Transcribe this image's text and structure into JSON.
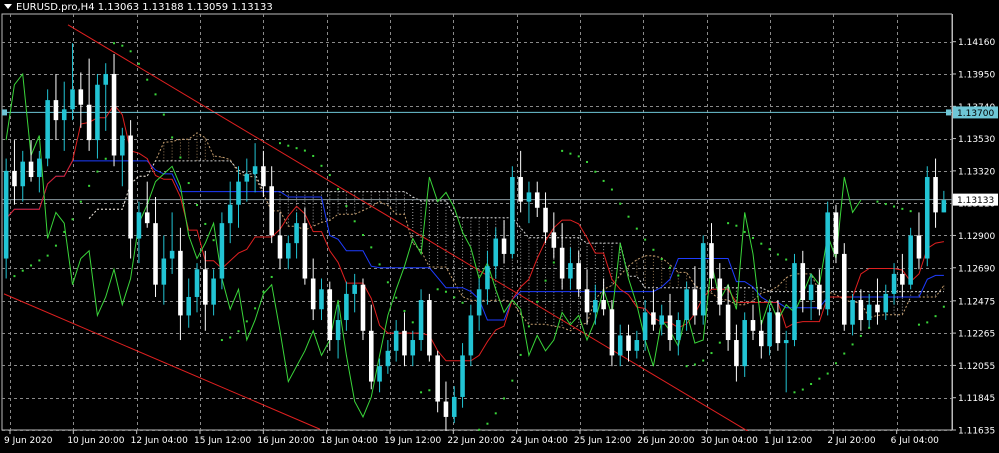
{
  "window": {
    "symbol_line": "EURUSD.pro,H4  1.13063 1.13188 1.13059 1.13133"
  },
  "colors": {
    "background": "#000000",
    "grid": "#8a8a8a",
    "bull_candle": "#22c4d4",
    "bear_candle": "#ffffff",
    "hline": "#6ec6d6",
    "trendline": "#e02020",
    "tenkan": "#e02020",
    "kijun": "#1e3cff",
    "chikou": "#3ad63a",
    "psar": "#3ad63a",
    "cloud_a": "#c8a070",
    "cloud_b": "#d8d8d8"
  },
  "price_axis": {
    "min": 1.11635,
    "max": 1.1434,
    "ticks": [
      "1.14160",
      "1.13950",
      "1.13740",
      "1.13530",
      "1.13320",
      "1.13110",
      "1.12900",
      "1.12690",
      "1.12475",
      "1.12265",
      "1.12055",
      "1.11845",
      "1.11635"
    ],
    "hline_label": "1.13700",
    "hline_price": 1.137,
    "current_label": "1.13133",
    "current_price": 1.13133
  },
  "time_axis": {
    "labels": [
      "9 Jun 2020",
      "10 Jun 20:00",
      "12 Jun 04:00",
      "15 Jun 12:00",
      "16 Jun 20:00",
      "18 Jun 04:00",
      "19 Jun 12:00",
      "22 Jun 20:00",
      "24 Jun 04:00",
      "25 Jun 12:00",
      "26 Jun 20:00",
      "30 Jun 04:00",
      "1 Jul 12:00",
      "2 Jul 20:00",
      "6 Jul 04:00"
    ]
  },
  "chart_data": {
    "type": "candlestick",
    "series": [
      {
        "name": "EURUSD.pro,H4",
        "candles": [
          [
            1.1275,
            1.134,
            1.1262,
            1.1332
          ],
          [
            1.1332,
            1.1352,
            1.131,
            1.1322
          ],
          [
            1.1322,
            1.1345,
            1.1312,
            1.1338
          ],
          [
            1.1338,
            1.1352,
            1.1325,
            1.1328
          ],
          [
            1.1328,
            1.1345,
            1.1318,
            1.134
          ],
          [
            1.134,
            1.1385,
            1.1335,
            1.1378
          ],
          [
            1.1378,
            1.1395,
            1.1352,
            1.1365
          ],
          [
            1.1365,
            1.139,
            1.1345,
            1.1372
          ],
          [
            1.1372,
            1.1415,
            1.1365,
            1.1385
          ],
          [
            1.1385,
            1.1396,
            1.136,
            1.1375
          ],
          [
            1.1375,
            1.1405,
            1.1345,
            1.1352
          ],
          [
            1.1352,
            1.1395,
            1.134,
            1.1388
          ],
          [
            1.1388,
            1.1402,
            1.1358,
            1.1395
          ],
          [
            1.1395,
            1.1408,
            1.1335,
            1.1342
          ],
          [
            1.1342,
            1.136,
            1.1322,
            1.1355
          ],
          [
            1.1355,
            1.1365,
            1.1275,
            1.1288
          ],
          [
            1.1288,
            1.1312,
            1.1272,
            1.1305
          ],
          [
            1.1305,
            1.1325,
            1.1295,
            1.1298
          ],
          [
            1.1298,
            1.1315,
            1.125,
            1.1258
          ],
          [
            1.1258,
            1.129,
            1.1245,
            1.1275
          ],
          [
            1.1275,
            1.1305,
            1.1265,
            1.128
          ],
          [
            1.128,
            1.1295,
            1.1222,
            1.1238
          ],
          [
            1.1238,
            1.1262,
            1.123,
            1.125
          ],
          [
            1.125,
            1.1272,
            1.124,
            1.1268
          ],
          [
            1.1268,
            1.128,
            1.1228,
            1.1245
          ],
          [
            1.1245,
            1.1268,
            1.1238,
            1.1262
          ],
          [
            1.1262,
            1.1305,
            1.1255,
            1.1298
          ],
          [
            1.1298,
            1.1325,
            1.1285,
            1.131
          ],
          [
            1.131,
            1.1335,
            1.1295,
            1.1325
          ],
          [
            1.1325,
            1.134,
            1.1312,
            1.133
          ],
          [
            1.133,
            1.135,
            1.1318,
            1.1335
          ],
          [
            1.1335,
            1.1345,
            1.1315,
            1.1322
          ],
          [
            1.1322,
            1.1335,
            1.1285,
            1.129
          ],
          [
            1.129,
            1.1305,
            1.1268,
            1.1275
          ],
          [
            1.1275,
            1.129,
            1.1268,
            1.1285
          ],
          [
            1.1285,
            1.1305,
            1.1275,
            1.1298
          ],
          [
            1.1298,
            1.1308,
            1.1258,
            1.1262
          ],
          [
            1.1262,
            1.1275,
            1.1235,
            1.1242
          ],
          [
            1.1242,
            1.1262,
            1.1235,
            1.1255
          ],
          [
            1.1255,
            1.126,
            1.1215,
            1.1222
          ],
          [
            1.1222,
            1.1245,
            1.121,
            1.1235
          ],
          [
            1.1235,
            1.126,
            1.1228,
            1.1252
          ],
          [
            1.1252,
            1.1265,
            1.124,
            1.1258
          ],
          [
            1.1258,
            1.1262,
            1.1222,
            1.1228
          ],
          [
            1.1228,
            1.1245,
            1.119,
            1.1195
          ],
          [
            1.1195,
            1.121,
            1.1188,
            1.1205
          ],
          [
            1.1205,
            1.1222,
            1.12,
            1.1215
          ],
          [
            1.1215,
            1.1235,
            1.1208,
            1.1228
          ],
          [
            1.1228,
            1.124,
            1.1205,
            1.1212
          ],
          [
            1.1212,
            1.1228,
            1.1205,
            1.1222
          ],
          [
            1.1222,
            1.1255,
            1.1215,
            1.1248
          ],
          [
            1.1248,
            1.1252,
            1.1208,
            1.1212
          ],
          [
            1.1212,
            1.1215,
            1.1175,
            1.1182
          ],
          [
            1.1182,
            1.1195,
            1.1162,
            1.1172
          ],
          [
            1.1172,
            1.1192,
            1.1168,
            1.1185
          ],
          [
            1.1185,
            1.122,
            1.1178,
            1.1212
          ],
          [
            1.1212,
            1.1245,
            1.1205,
            1.1238
          ],
          [
            1.1238,
            1.1262,
            1.1228,
            1.1255
          ],
          [
            1.1255,
            1.128,
            1.1245,
            1.127
          ],
          [
            1.127,
            1.1295,
            1.1262,
            1.1288
          ],
          [
            1.1288,
            1.13,
            1.1272,
            1.1278
          ],
          [
            1.1278,
            1.1335,
            1.1275,
            1.1328
          ],
          [
            1.1328,
            1.1345,
            1.1305,
            1.1312
          ],
          [
            1.1312,
            1.1325,
            1.1298,
            1.1318
          ],
          [
            1.1318,
            1.1325,
            1.1302,
            1.1308
          ],
          [
            1.1308,
            1.1318,
            1.1285,
            1.1292
          ],
          [
            1.1292,
            1.1305,
            1.1275,
            1.1282
          ],
          [
            1.1282,
            1.1298,
            1.1255,
            1.1262
          ],
          [
            1.1262,
            1.1282,
            1.1255,
            1.1272
          ],
          [
            1.1272,
            1.128,
            1.125,
            1.1255
          ],
          [
            1.1255,
            1.1268,
            1.1232,
            1.124
          ],
          [
            1.124,
            1.1258,
            1.1232,
            1.1248
          ],
          [
            1.1248,
            1.1262,
            1.1238,
            1.1242
          ],
          [
            1.1242,
            1.1248,
            1.1205,
            1.1212
          ],
          [
            1.1212,
            1.1232,
            1.1205,
            1.1225
          ],
          [
            1.1225,
            1.1232,
            1.1208,
            1.1215
          ],
          [
            1.1215,
            1.1228,
            1.121,
            1.1222
          ],
          [
            1.1222,
            1.1248,
            1.1215,
            1.124
          ],
          [
            1.124,
            1.1255,
            1.1228,
            1.1232
          ],
          [
            1.1232,
            1.1245,
            1.1225,
            1.1238
          ],
          [
            1.1238,
            1.1252,
            1.1215,
            1.1222
          ],
          [
            1.1222,
            1.124,
            1.1212,
            1.1235
          ],
          [
            1.1235,
            1.126,
            1.1228,
            1.1255
          ],
          [
            1.1255,
            1.127,
            1.1232,
            1.1238
          ],
          [
            1.1238,
            1.129,
            1.1232,
            1.1285
          ],
          [
            1.1285,
            1.1298,
            1.1255,
            1.1262
          ],
          [
            1.1262,
            1.1272,
            1.1238,
            1.1245
          ],
          [
            1.1245,
            1.1258,
            1.1215,
            1.1222
          ],
          [
            1.1222,
            1.1232,
            1.1195,
            1.1205
          ],
          [
            1.1205,
            1.124,
            1.1198,
            1.1235
          ],
          [
            1.1235,
            1.1245,
            1.1222,
            1.1228
          ],
          [
            1.1228,
            1.1235,
            1.121,
            1.1218
          ],
          [
            1.1218,
            1.1245,
            1.1212,
            1.124
          ],
          [
            1.124,
            1.1248,
            1.1215,
            1.122
          ],
          [
            1.122,
            1.1228,
            1.1188,
            1.1222
          ],
          [
            1.1222,
            1.1278,
            1.1218,
            1.1272
          ],
          [
            1.1272,
            1.128,
            1.124,
            1.1248
          ],
          [
            1.1248,
            1.1265,
            1.1235,
            1.1258
          ],
          [
            1.1258,
            1.1268,
            1.1238,
            1.1242
          ],
          [
            1.1242,
            1.1312,
            1.1238,
            1.1305
          ],
          [
            1.1305,
            1.131,
            1.1272,
            1.1278
          ],
          [
            1.1278,
            1.1285,
            1.1228,
            1.1232
          ],
          [
            1.1232,
            1.1252,
            1.1225,
            1.1248
          ],
          [
            1.1248,
            1.1255,
            1.1228,
            1.1235
          ],
          [
            1.1235,
            1.1252,
            1.123,
            1.1245
          ],
          [
            1.1245,
            1.1262,
            1.1232,
            1.124
          ],
          [
            1.124,
            1.1258,
            1.1235,
            1.1252
          ],
          [
            1.1252,
            1.1272,
            1.1245,
            1.1265
          ],
          [
            1.1265,
            1.1278,
            1.125,
            1.1258
          ],
          [
            1.1258,
            1.1295,
            1.1255,
            1.129
          ],
          [
            1.129,
            1.1305,
            1.1268,
            1.1275
          ],
          [
            1.1275,
            1.1335,
            1.127,
            1.1328
          ],
          [
            1.1328,
            1.134,
            1.1295,
            1.1305
          ],
          [
            1.1305,
            1.1319,
            1.1305,
            1.1313
          ]
        ]
      }
    ],
    "indicators": [
      "Ichimoku Kinko Hyo",
      "Parabolic SAR",
      "Trendlines"
    ]
  }
}
